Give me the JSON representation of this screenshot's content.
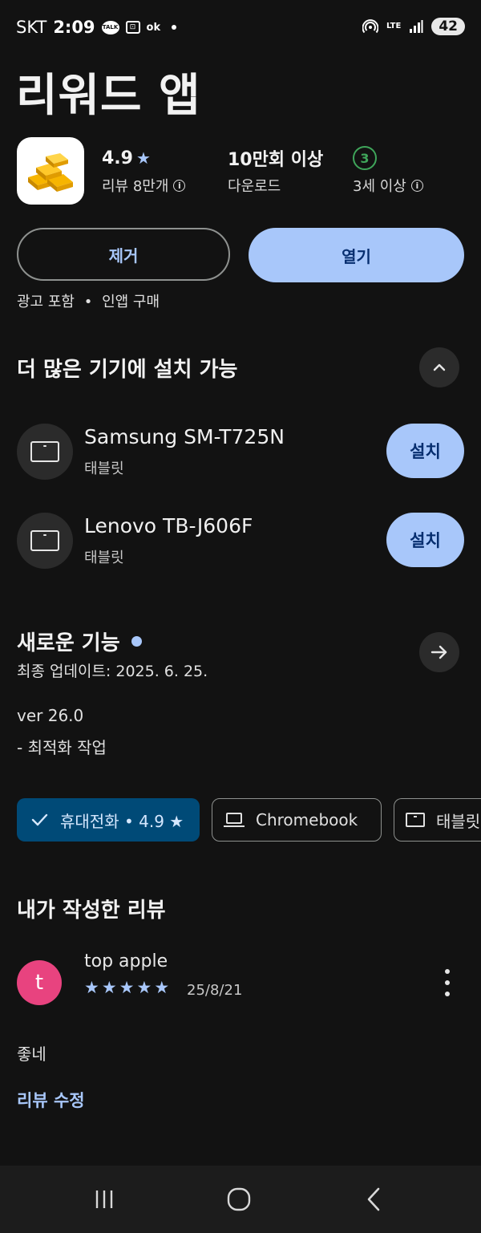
{
  "status_bar": {
    "carrier": "SKT",
    "time": "2:09",
    "talk_icon_text": "TALK",
    "ok_text": "ok",
    "network": "LTE",
    "battery": "42"
  },
  "app": {
    "title": "리워드 앱",
    "rating": "4.9",
    "reviews_label": "리뷰 8만개",
    "downloads_value": "10만회 이상",
    "downloads_label": "다운로드",
    "age_badge": "3",
    "age_label": "3세 이상"
  },
  "actions": {
    "uninstall_label": "제거",
    "open_label": "열기"
  },
  "meta": {
    "ads": "광고 포함",
    "separator": "•",
    "iap": "인앱 구매"
  },
  "devices_section": {
    "title": "더 많은 기기에 설치 가능",
    "devices": [
      {
        "name": "Samsung SM-T725N",
        "type": "태블릿",
        "install_label": "설치"
      },
      {
        "name": "Lenovo TB-J606F",
        "type": "태블릿",
        "install_label": "설치"
      }
    ]
  },
  "whats_new": {
    "title": "새로운 기능",
    "last_updated": "최종 업데이트: 2025. 6. 25.",
    "version": "ver 26.0",
    "note": "- 최적화 작업"
  },
  "device_chips": [
    {
      "label": "휴대전화 • 4.9 ★",
      "selected": true
    },
    {
      "label": "Chromebook",
      "selected": false
    },
    {
      "label": "태블릿",
      "selected": false
    }
  ],
  "my_review": {
    "title": "내가 작성한 리뷰",
    "avatar_letter": "t",
    "reviewer": "top apple",
    "stars": 5,
    "date": "25/8/21",
    "text": "좋네",
    "edit_label": "리뷰 수정"
  },
  "colors": {
    "accent": "#a8c7fa",
    "accent_dark_text": "#062e6f",
    "chip_selected": "#004a77",
    "avatar": "#e8437f",
    "age_green": "#3fa55a",
    "background": "#121212"
  },
  "icons": {
    "hotspot": "hotspot-icon",
    "signal": "signal-icon",
    "info": "info-icon",
    "chevron_up": "chevron-up-icon",
    "arrow_right": "arrow-right-icon",
    "check": "check-icon",
    "laptop": "laptop-icon",
    "tablet": "tablet-icon",
    "more": "more-vert-icon",
    "nav_recents": "recents-icon",
    "nav_home": "home-icon",
    "nav_back": "back-icon"
  }
}
